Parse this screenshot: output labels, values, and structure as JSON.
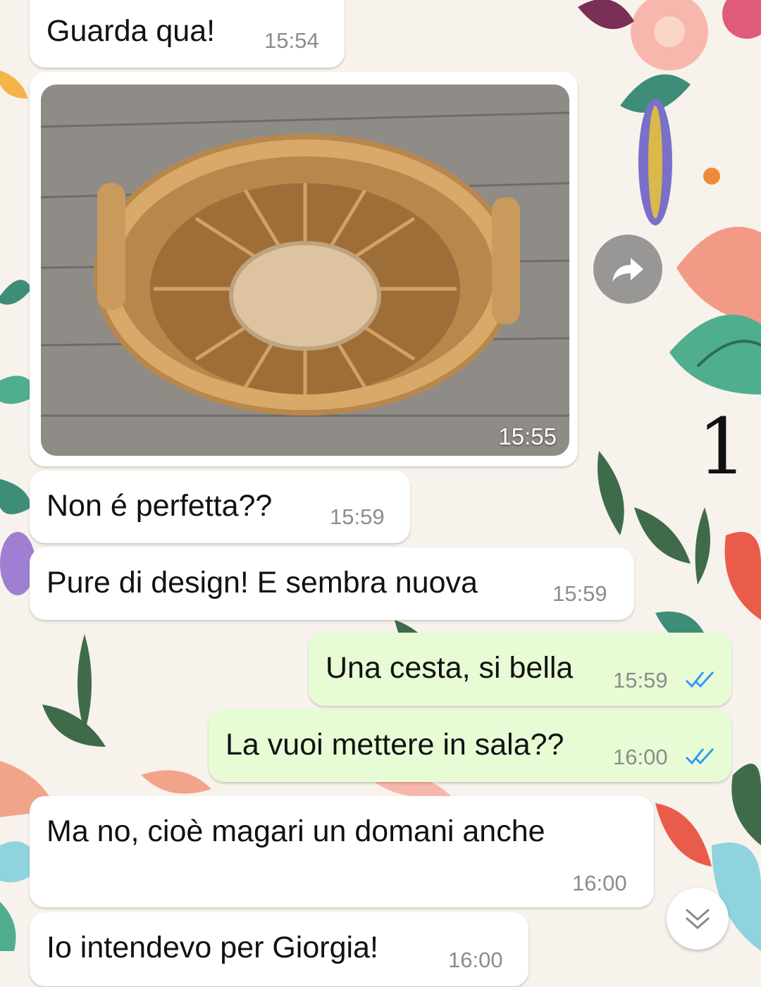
{
  "chat": {
    "messages": [
      {
        "direction": "incoming",
        "text": "Guarda qua!",
        "time": "15:54"
      },
      {
        "direction": "incoming",
        "type": "photo",
        "time": "15:55",
        "photo_subject": "wicker basket on wooden floor"
      },
      {
        "direction": "incoming",
        "text": "Non é perfetta??",
        "time": "15:59"
      },
      {
        "direction": "incoming",
        "text": "Pure di design! E sembra nuova",
        "time": "15:59"
      },
      {
        "direction": "outgoing",
        "text": "Una cesta, si bella",
        "time": "15:59",
        "status": "read"
      },
      {
        "direction": "outgoing",
        "text": "La vuoi mettere in sala??",
        "time": "16:00",
        "status": "read"
      },
      {
        "direction": "incoming",
        "text": "Ma no, cioè magari un domani anche",
        "time": "16:00"
      },
      {
        "direction": "incoming",
        "text": "Io intendevo per Giorgia!",
        "time": "16:00"
      }
    ]
  },
  "overlay": {
    "page_number": "1"
  },
  "icons": {
    "forward": "forward-arrow-icon",
    "scroll_down": "double-chevron-down-icon",
    "read_receipt": "double-check-icon"
  },
  "colors": {
    "incoming_bubble": "#ffffff",
    "outgoing_bubble": "#e7fcd5",
    "timestamp": "#8c8c8c",
    "read_check": "#3497f9"
  }
}
